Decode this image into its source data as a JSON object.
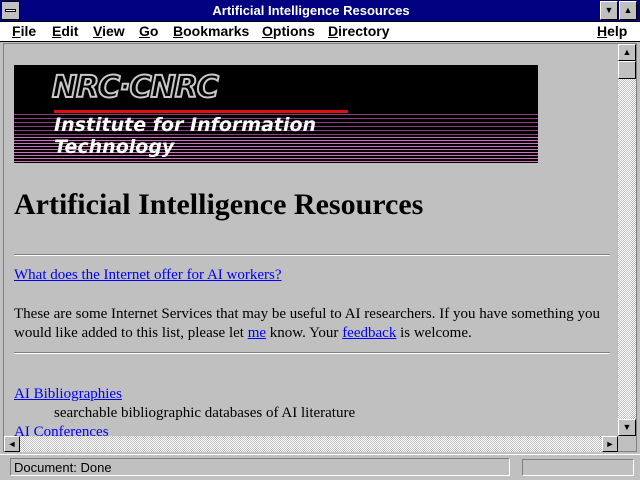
{
  "window": {
    "title": "Artificial Intelligence Resources"
  },
  "menu": {
    "items": [
      "File",
      "Edit",
      "View",
      "Go",
      "Bookmarks",
      "Options",
      "Directory",
      "Help"
    ]
  },
  "banner": {
    "logo_text": "NRC·CNRC",
    "institute_line1": "Institute for Information",
    "institute_line2": "Technology"
  },
  "page": {
    "heading": "Artificial Intelligence Resources",
    "intro_link": "What does the Internet offer for AI workers?",
    "body_line1": "These are some Internet Services that may be useful to AI researchers. If you have something you",
    "body_line2_a": "would like added to this list, please let",
    "body_line2_link_me": "me",
    "body_line2_b": "know. Your",
    "body_line2_link_feedback": "feedback",
    "body_line2_c": "is welcome.",
    "items": [
      {
        "label": "AI Bibliographies",
        "desc": "searchable bibliographic databases of AI literature"
      },
      {
        "label": "AI Conferences"
      }
    ]
  },
  "status": {
    "text": "Document: Done"
  }
}
